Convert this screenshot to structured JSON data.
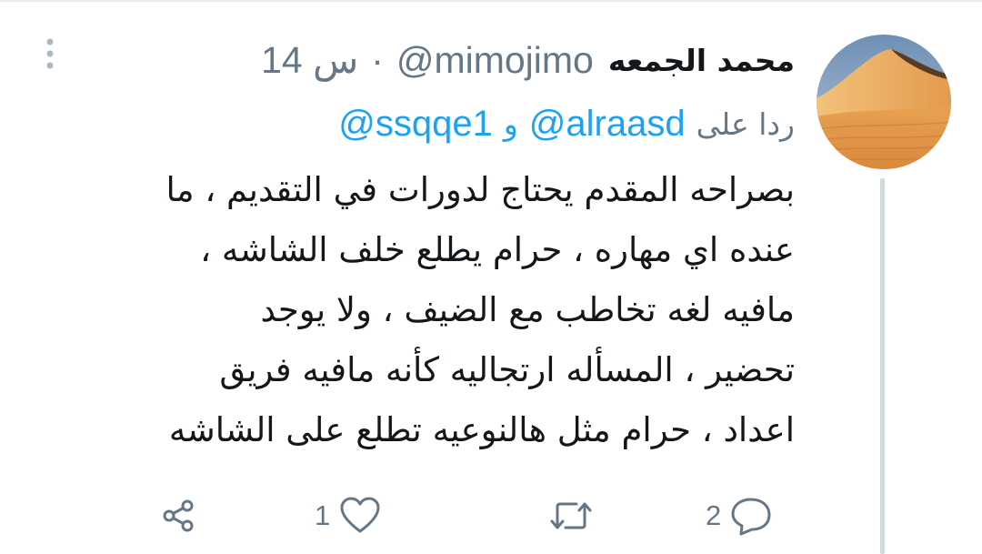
{
  "tweet": {
    "author_name": "محمد الجمعه",
    "handle": "@mimojimo",
    "separator": "·",
    "time": "14 س",
    "reply_label": "ردا على",
    "reply_mentions": [
      "@alraasd",
      "@ssqqe1"
    ],
    "reply_conjunction": "و",
    "text_lines": [
      "بصراحه المقدم يحتاج لدورات في التقديم ، ما",
      "عنده اي مهاره ، حرام يطلع خلف الشاشه ،",
      "مافيه لغه تخاطب مع الضيف ، ولا يوجد",
      "تحضير ، المسأله ارتجاليه كأنه مافيه فريق",
      "اعداد ، حرام مثل هالنوعيه تطلع على الشاشه"
    ],
    "actions": {
      "reply_count": "2",
      "like_count": "1"
    }
  },
  "icons": {
    "more": "vertical-ellipsis-icon",
    "reply": "speech-bubble-icon",
    "retweet": "retweet-arrows-icon",
    "like": "heart-outline-icon",
    "share": "share-nodes-icon",
    "avatar": "desert-dune-avatar"
  },
  "colors": {
    "link": "#1da1f2",
    "secondary_text": "#657786",
    "primary_text": "#14171a",
    "thread_line": "#cfd9de"
  }
}
